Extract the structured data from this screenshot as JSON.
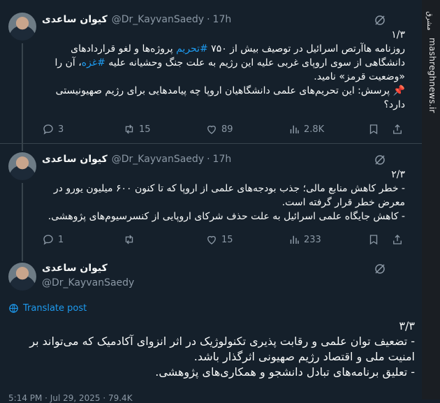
{
  "author": {
    "name": "کیوان ساعدی",
    "handle": "@Dr_KayvanSaedy"
  },
  "tweets": [
    {
      "time": "17h",
      "number": "۱/۳",
      "text_before": "روزنامه هاآرتص اسرائیل در توصیف بیش از ۷۵۰ ",
      "hashtag1": "#تحریم",
      "text_middle": " پروژه‌ها و لغو قراردادهای دانشگاهی از سوی اروپای غربی علیه این رژیم به علت جنگ وحشیانه علیه ",
      "hashtag2": "#غزه",
      "text_after": "، آن را «وضعیت قرمز» نامید.",
      "pin_icon": "📌",
      "question": "پرسش: این تحریم‌های علمی دانشگاهیان اروپا چه پیامدهایی برای رژیم صهیونیستی دارد؟",
      "replies": "3",
      "reposts": "15",
      "likes": "89",
      "views": "2.8K"
    },
    {
      "time": "17h",
      "number": "۲/۳",
      "text": "- خطر کاهش منابع مالی؛ جذب بودجه‌های علمی از اروپا که تا کنون ۶۰۰ میلیون یورو در معرض خطر قرار گرفته است.\n- کاهش جایگاه علمی اسرائیل به علت حذف شرکای اروپایی از کنسرسیوم‌های پژوهشی.",
      "replies": "1",
      "reposts": "",
      "likes": "15",
      "views": "233"
    }
  ],
  "main_tweet": {
    "translate_label": "Translate post",
    "number": "۳/۳",
    "text": "- تضعیف توان علمی و رقابت پذیری تکنولوژیک در اثر انزوای آکادمیک که می‌تواند بر امنیت ملی و اقتصاد رژیم صهیونی اثرگذار باشد.\n- تعلیق برنامه‌های تبادل دانشجو و همکاری‌های پژوهشی.",
    "footer": "5:14 PM · Jul 29, 2025 · 79.4K"
  },
  "sidebar": {
    "logo_text": "مشرق",
    "site_text": "mashreghnews.ir"
  },
  "colors": {
    "background": "#15202b",
    "accent": "#1d9bf0",
    "muted": "#8b98a5"
  }
}
